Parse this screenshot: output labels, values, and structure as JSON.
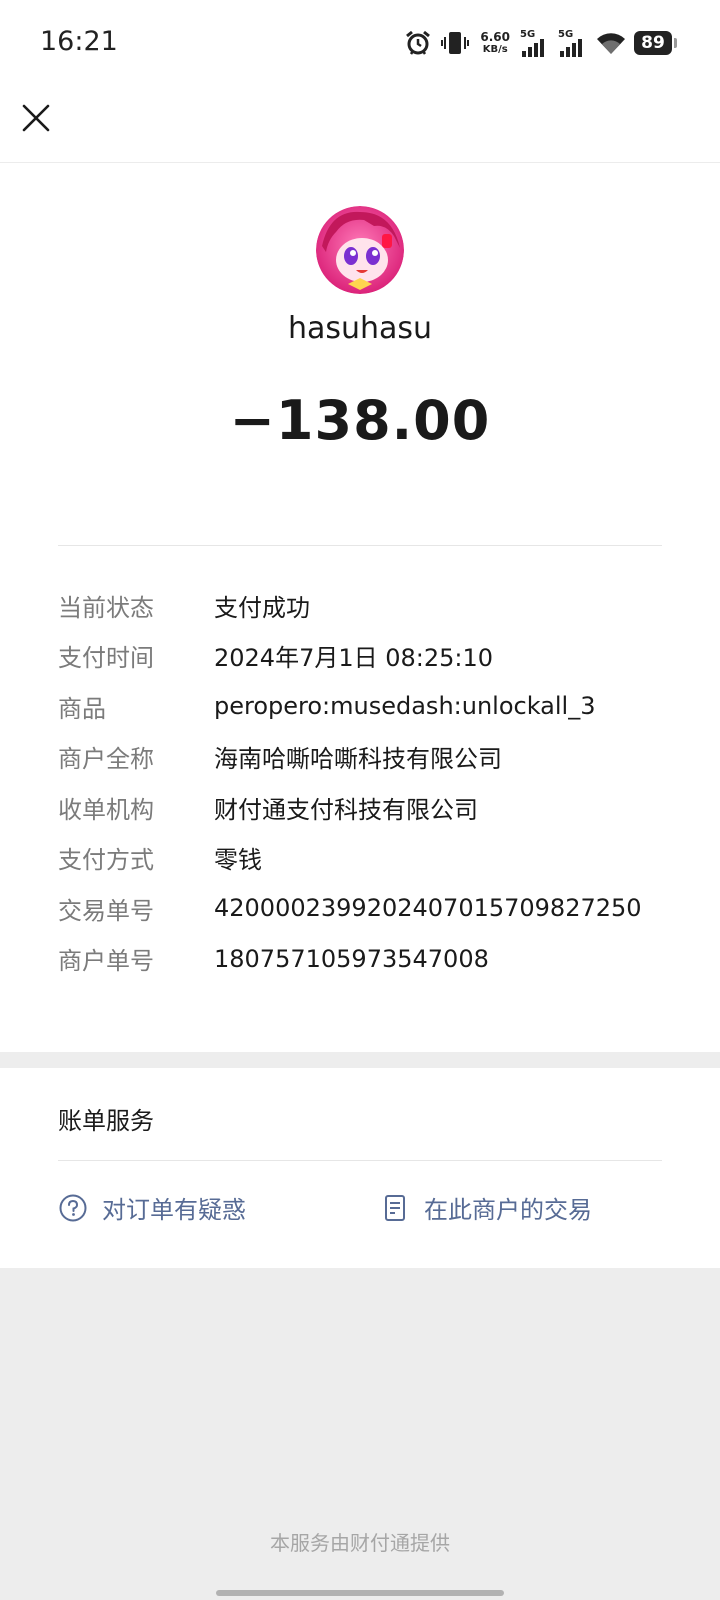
{
  "status_bar": {
    "time": "16:21",
    "net_speed_value": "6.60",
    "net_speed_unit": "KB/s",
    "sim1_label": "5G",
    "sim2_label": "5G",
    "battery": "89",
    "icons": [
      "alarm-icon",
      "vibrate-icon",
      "signal-icon",
      "signal-icon",
      "wifi-icon",
      "battery-icon"
    ]
  },
  "nav": {
    "close_icon": "close-icon"
  },
  "payee": {
    "name": "hasuhasu",
    "amount": "−138.00"
  },
  "details": [
    {
      "label": "当前状态",
      "value": "支付成功"
    },
    {
      "label": "支付时间",
      "value": "2024年7月1日 08:25:10"
    },
    {
      "label": "商品",
      "value": "peropero:musedash:unlockall_3"
    },
    {
      "label": "商户全称",
      "value": "海南哈嘶哈嘶科技有限公司"
    },
    {
      "label": "收单机构",
      "value": "财付通支付科技有限公司"
    },
    {
      "label": "支付方式",
      "value": "零钱"
    },
    {
      "label": "交易单号",
      "value": "4200002399202407015709827250"
    },
    {
      "label": "商户单号",
      "value": "180757105973547008"
    }
  ],
  "service": {
    "title": "账单服务",
    "question_link": "对订单有疑惑",
    "merchant_link": "在此商户的交易"
  },
  "footer": {
    "note": "本服务由财付通提供"
  },
  "colors": {
    "link": "#576b95",
    "label": "#7b7b7b",
    "background": "#ededed"
  }
}
